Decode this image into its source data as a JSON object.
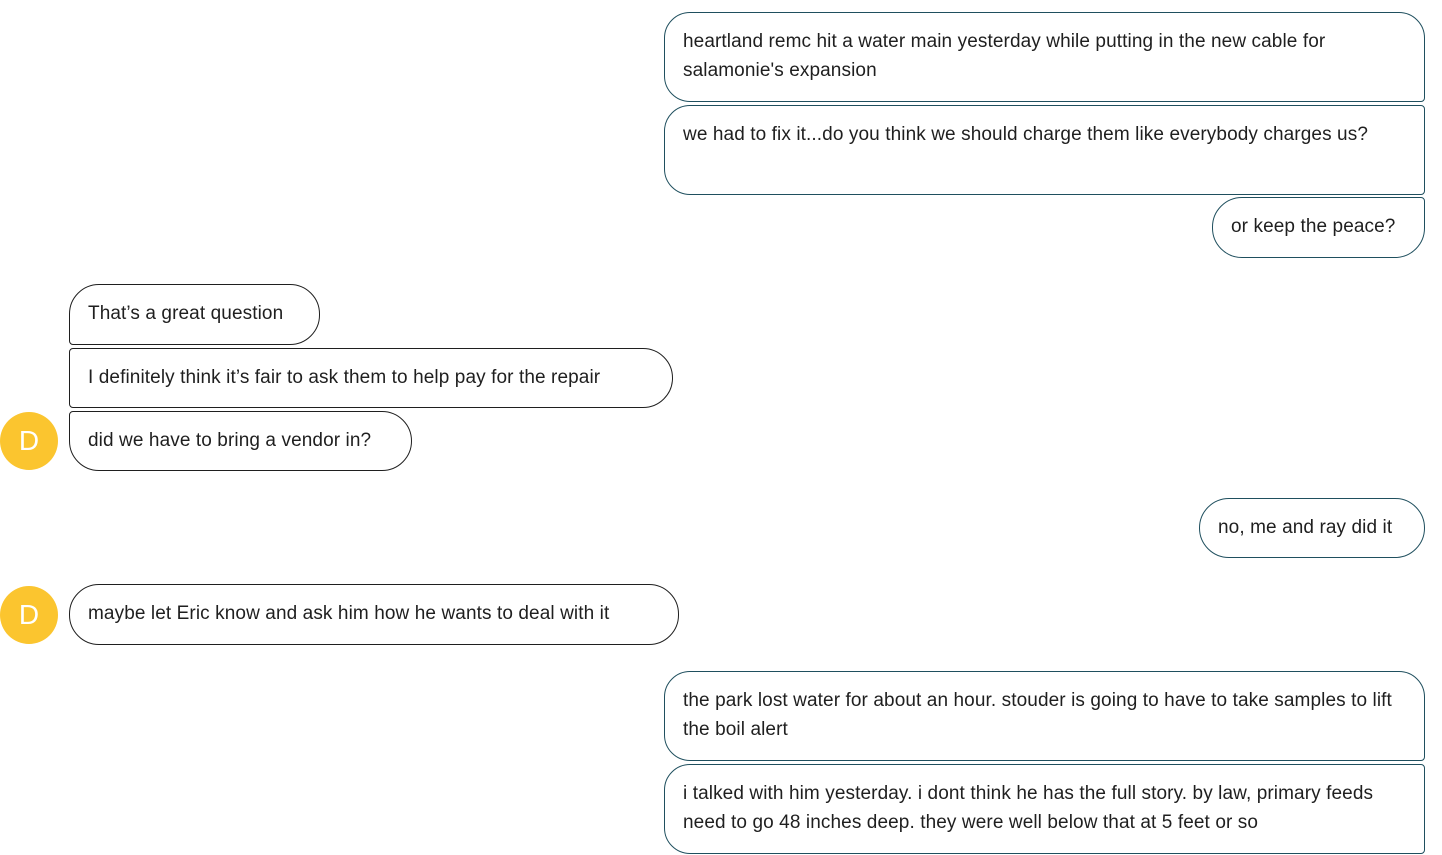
{
  "messages": [
    {
      "sender": "me",
      "text": "heartland remc hit a water main yesterday while putting in the new cable for salamonie's expansion"
    },
    {
      "sender": "me",
      "text": "we had to fix it...do you think we should charge them like everybody charges us?"
    },
    {
      "sender": "me",
      "text": "or keep the peace?"
    },
    {
      "sender": "D",
      "text": "That’s a great question"
    },
    {
      "sender": "D",
      "text": "I definitely think it’s fair to ask them to help pay for the repair"
    },
    {
      "sender": "D",
      "text": "did we have to bring a vendor in?"
    },
    {
      "sender": "me",
      "text": "no, me and ray did it"
    },
    {
      "sender": "D",
      "text": "maybe let Eric know and ask him how he wants to deal with it"
    },
    {
      "sender": "me",
      "text": "the park lost water for about an hour.  stouder is going to have to take samples to lift the boil alert"
    },
    {
      "sender": "me",
      "text": "i talked with him yesterday.  i dont think he has the full story.  by law, primary feeds need to go 48 inches deep.  they were well below that at 5 feet or so"
    }
  ],
  "avatars": [
    {
      "initial": "D",
      "color": "#fbc52f"
    },
    {
      "initial": "D",
      "color": "#fbc52f"
    }
  ]
}
